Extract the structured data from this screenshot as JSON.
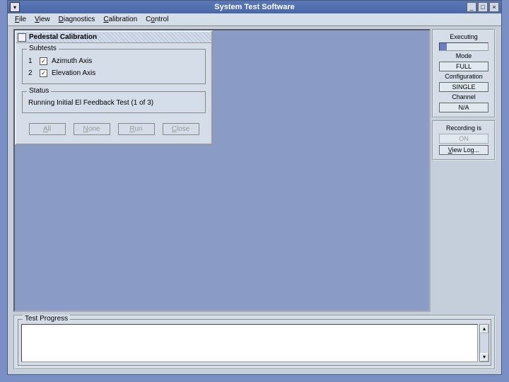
{
  "window": {
    "title": "System Test Software",
    "menu": [
      "File",
      "View",
      "Diagnostics",
      "Calibration",
      "Control"
    ]
  },
  "side": {
    "executing_label": "Executing",
    "mode_label": "Mode",
    "mode_value": "FULL",
    "config_label": "Configuration",
    "config_value": "SINGLE",
    "channel_label": "Channel",
    "channel_value": "N/A",
    "recording_label": "Recording is",
    "recording_value": "ON",
    "viewlog_label": "View Log..."
  },
  "dialog": {
    "title": "Pedestal Calibration",
    "subtests_legend": "Subtests",
    "subtests": [
      {
        "num": "1",
        "checked": true,
        "label": "Azimuth Axis"
      },
      {
        "num": "2",
        "checked": true,
        "label": "Elevation Axis"
      }
    ],
    "status_legend": "Status",
    "status_text": "Running Initial El Feedback Test (1 of 3)",
    "buttons": {
      "all": "All",
      "none": "None",
      "run": "Run",
      "close": "Close"
    }
  },
  "bottom": {
    "legend": "Test Progress"
  }
}
